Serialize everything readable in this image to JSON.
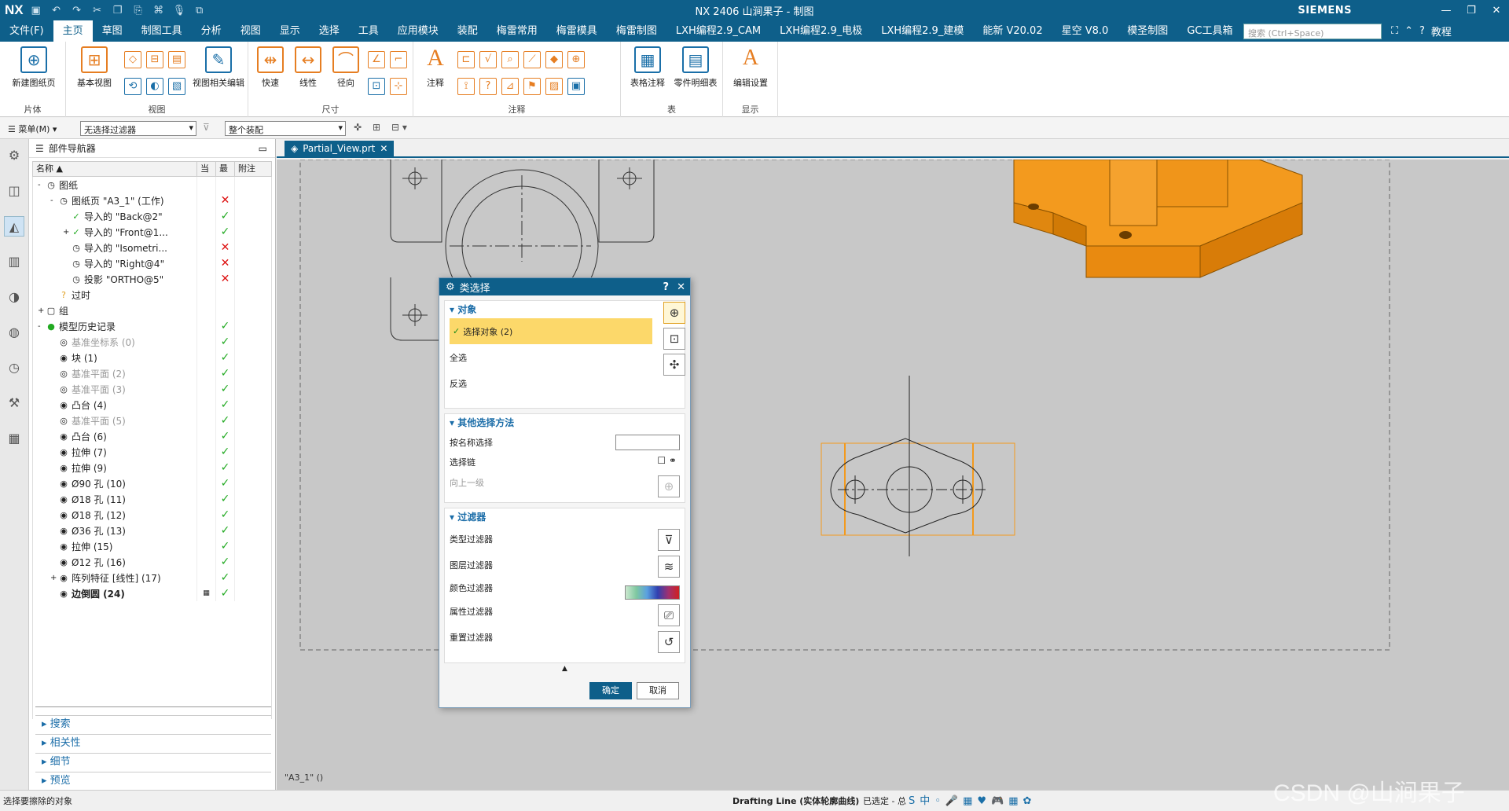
{
  "app": {
    "logo": "NX",
    "title": "NX 2406 山涧果子 - 制图",
    "brand": "SIEMENS",
    "accent": "#0e5f8a",
    "selection_orange": "#f39a1e"
  },
  "menubar": {
    "items": [
      "文件(F)",
      "主页",
      "草图",
      "制图工具",
      "分析",
      "视图",
      "显示",
      "选择",
      "工具",
      "应用模块",
      "装配",
      "梅雷常用",
      "梅雷模具",
      "梅雷制图",
      "LXH编程2.9_CAM",
      "LXH编程2.9_电极",
      "LXH编程2.9_建模",
      "能新 V20.02",
      "星空 V8.0",
      "模圣制图",
      "GC工具箱"
    ],
    "active_index": 1,
    "search_placeholder": "搜索 (Ctrl+Space)",
    "help_label": "教程"
  },
  "ribbon": {
    "groups": [
      {
        "label": "片体",
        "buttons": [
          "新建图纸页"
        ]
      },
      {
        "label": "视图",
        "buttons": [
          "基本视图",
          "视图相关编辑"
        ]
      },
      {
        "label": "尺寸",
        "buttons": [
          "快速",
          "线性",
          "径向"
        ]
      },
      {
        "label": "注释",
        "buttons": [
          "注释"
        ]
      },
      {
        "label": "表",
        "buttons": [
          "表格注释",
          "零件明细表"
        ]
      },
      {
        "label": "显示",
        "buttons": [
          "编辑设置"
        ]
      }
    ]
  },
  "filterbar": {
    "menu_label": "菜单(M)",
    "filter_value": "无选择过滤器",
    "scope_value": "整个装配"
  },
  "navigator": {
    "title": "部件导航器",
    "columns": [
      "名称",
      "当",
      "最",
      "附注"
    ],
    "rows": [
      {
        "indent": 0,
        "expander": "-",
        "icon": "◷",
        "label": "图纸",
        "c1": "",
        "c2": "",
        "style": ""
      },
      {
        "indent": 1,
        "expander": "-",
        "icon": "◷",
        "label": "图纸页 \"A3_1\" (工作)",
        "c1": "",
        "c2": "✕",
        "style": ""
      },
      {
        "indent": 2,
        "expander": "",
        "icon": "✓",
        "label": "导入的 \"Back@2\"",
        "c1": "",
        "c2": "✓",
        "style": ""
      },
      {
        "indent": 2,
        "expander": "+",
        "icon": "✓",
        "label": "导入的 \"Front@1...",
        "c1": "",
        "c2": "✓",
        "style": ""
      },
      {
        "indent": 2,
        "expander": "",
        "icon": "◷",
        "label": "导入的 \"Isometri...",
        "c1": "",
        "c2": "✕",
        "style": ""
      },
      {
        "indent": 2,
        "expander": "",
        "icon": "◷",
        "label": "导入的 \"Right@4\"",
        "c1": "",
        "c2": "✕",
        "style": ""
      },
      {
        "indent": 2,
        "expander": "",
        "icon": "◷",
        "label": "投影 \"ORTHO@5\"",
        "c1": "",
        "c2": "✕",
        "style": ""
      },
      {
        "indent": 1,
        "expander": "",
        "icon": "?",
        "label": "过时",
        "c1": "",
        "c2": "",
        "style": ""
      },
      {
        "indent": 0,
        "expander": "+",
        "icon": "▢",
        "label": "组",
        "c1": "",
        "c2": "",
        "style": ""
      },
      {
        "indent": 0,
        "expander": "-",
        "icon": "●",
        "label": "模型历史记录",
        "c1": "",
        "c2": "✓",
        "style": ""
      },
      {
        "indent": 1,
        "expander": "",
        "icon": "◎",
        "label": "基准坐标系 (0)",
        "c1": "",
        "c2": "✓",
        "style": "grey"
      },
      {
        "indent": 1,
        "expander": "",
        "icon": "◉",
        "label": "块 (1)",
        "c1": "",
        "c2": "✓",
        "style": ""
      },
      {
        "indent": 1,
        "expander": "",
        "icon": "◎",
        "label": "基准平面 (2)",
        "c1": "",
        "c2": "✓",
        "style": "grey"
      },
      {
        "indent": 1,
        "expander": "",
        "icon": "◎",
        "label": "基准平面 (3)",
        "c1": "",
        "c2": "✓",
        "style": "grey"
      },
      {
        "indent": 1,
        "expander": "",
        "icon": "◉",
        "label": "凸台 (4)",
        "c1": "",
        "c2": "✓",
        "style": ""
      },
      {
        "indent": 1,
        "expander": "",
        "icon": "◎",
        "label": "基准平面 (5)",
        "c1": "",
        "c2": "✓",
        "style": "grey"
      },
      {
        "indent": 1,
        "expander": "",
        "icon": "◉",
        "label": "凸台 (6)",
        "c1": "",
        "c2": "✓",
        "style": ""
      },
      {
        "indent": 1,
        "expander": "",
        "icon": "◉",
        "label": "拉伸 (7)",
        "c1": "",
        "c2": "✓",
        "style": ""
      },
      {
        "indent": 1,
        "expander": "",
        "icon": "◉",
        "label": "拉伸 (9)",
        "c1": "",
        "c2": "✓",
        "style": ""
      },
      {
        "indent": 1,
        "expander": "",
        "icon": "◉",
        "label": "Ø90 孔 (10)",
        "c1": "",
        "c2": "✓",
        "style": ""
      },
      {
        "indent": 1,
        "expander": "",
        "icon": "◉",
        "label": "Ø18 孔 (11)",
        "c1": "",
        "c2": "✓",
        "style": ""
      },
      {
        "indent": 1,
        "expander": "",
        "icon": "◉",
        "label": "Ø18 孔 (12)",
        "c1": "",
        "c2": "✓",
        "style": ""
      },
      {
        "indent": 1,
        "expander": "",
        "icon": "◉",
        "label": "Ø36 孔 (13)",
        "c1": "",
        "c2": "✓",
        "style": ""
      },
      {
        "indent": 1,
        "expander": "",
        "icon": "◉",
        "label": "拉伸 (15)",
        "c1": "",
        "c2": "✓",
        "style": ""
      },
      {
        "indent": 1,
        "expander": "",
        "icon": "◉",
        "label": "Ø12 孔 (16)",
        "c1": "",
        "c2": "✓",
        "style": ""
      },
      {
        "indent": 1,
        "expander": "+",
        "icon": "◉",
        "label": "阵列特征 [线性] (17)",
        "c1": "",
        "c2": "✓",
        "style": ""
      },
      {
        "indent": 1,
        "expander": "",
        "icon": "◉",
        "label": "边倒圆 (24)",
        "c1": "▦",
        "c2": "✓",
        "style": "bold"
      }
    ],
    "accordions": [
      "搜索",
      "相关性",
      "细节",
      "预览"
    ]
  },
  "tab": {
    "label": "Partial_View.prt"
  },
  "canvas": {
    "sheet_label": "\"A3_1\" ()"
  },
  "dialog": {
    "title": "类选择",
    "sections": {
      "object": {
        "header": "对象",
        "select_label": "选择对象 (2)",
        "all_label": "全选",
        "invert_label": "反选"
      },
      "other": {
        "header": "其他选择方法",
        "by_name_label": "按名称选择",
        "by_name_value": "",
        "chain_label": "选择链",
        "up_label": "向上一级"
      },
      "filters": {
        "header": "过滤器",
        "type_label": "类型过滤器",
        "layer_label": "图层过滤器",
        "color_label": "颜色过滤器",
        "attr_label": "属性过滤器",
        "reset_label": "重置过滤器"
      }
    },
    "ok_label": "确定",
    "cancel_label": "取消"
  },
  "statusbar": {
    "prompt": "选择要擦除的对象",
    "filter_info": "Drafting Line  (实体轮廓曲线)",
    "selected_info": "已选定 - 总",
    "watermark": "CSDN @山涧果子"
  }
}
